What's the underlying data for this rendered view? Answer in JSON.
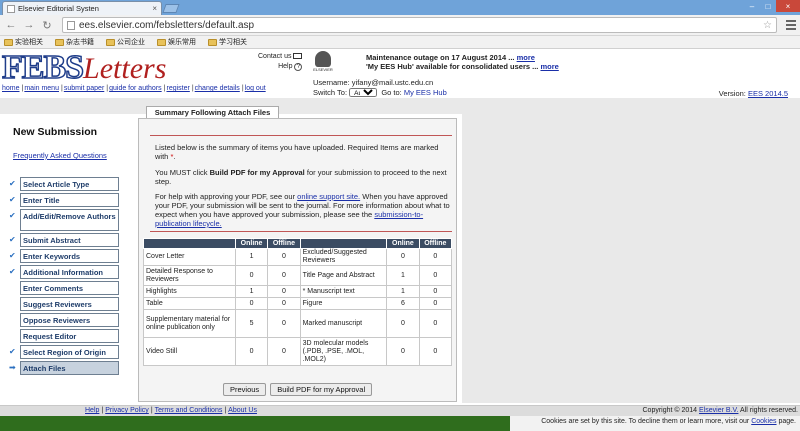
{
  "browser": {
    "tab_title": "Elsevier Editorial Systen",
    "tab_close": "×",
    "url": "ees.elsevier.com/febsletters/default.asp",
    "window_min": "–",
    "window_restore": "□",
    "window_close": "×",
    "bookmarks": [
      "实验相关",
      "杂志书籍",
      "公司企业",
      "娱乐常用",
      "学习相关"
    ]
  },
  "header": {
    "logo_febs": "FEBS",
    "logo_letters": "Letters",
    "contact_us": "Contact us",
    "help": "Help",
    "elsevier_label": "ELSEVIER",
    "maintenance_line1": "Maintenance outage on 17 August 2014 ...",
    "maintenance_more1": "more",
    "maintenance_line2": "'My EES Hub' available for consolidated users ...",
    "maintenance_more2": "more",
    "username_label": "Username:",
    "username": "yifany@mail.ustc.edu.cn",
    "switch_to_label": "Switch To:",
    "switch_to_value": "Author",
    "go_to_label": "Go to:",
    "go_to_link": "My EES Hub",
    "version_label": "Version:",
    "version_link": "EES 2014.5"
  },
  "topnav": [
    "home",
    "main menu",
    "submit paper",
    "guide for authors",
    "register",
    "change details",
    "log out"
  ],
  "sidebar": {
    "title": "New Submission",
    "faq": "Frequently Asked Questions",
    "steps": [
      {
        "label": "Select Article Type",
        "mark": "✔"
      },
      {
        "label": "Enter Title",
        "mark": "✔"
      },
      {
        "label": "Add/Edit/Remove Authors",
        "mark": "✔"
      },
      {
        "label": "Submit Abstract",
        "mark": "✔"
      },
      {
        "label": "Enter Keywords",
        "mark": "✔"
      },
      {
        "label": "Additional Information",
        "mark": "✔"
      },
      {
        "label": "Enter Comments",
        "mark": ""
      },
      {
        "label": "Suggest Reviewers",
        "mark": ""
      },
      {
        "label": "Oppose Reviewers",
        "mark": ""
      },
      {
        "label": "Request Editor",
        "mark": ""
      },
      {
        "label": "Select Region of Origin",
        "mark": "✔"
      },
      {
        "label": "Attach Files",
        "mark": "➡"
      }
    ]
  },
  "main": {
    "tab_title": "Summary Following Attach Files",
    "para1": "Listed below is the summary of items you have uploaded. Required Items are marked with",
    "para1_mark": "*",
    "para1_end": ".",
    "para2_start": "You MUST click",
    "para2_bold": "Build PDF for my Approval",
    "para2_end": "for your submission to proceed to the next step.",
    "para3_start": "For help with approving your PDF, see our",
    "para3_link1": "online support site.",
    "para3_mid": "When you have approved your PDF, your submission will be sent to the journal. For more information about what to expect when you have approved your submission, please see the",
    "para3_link2": "submission-to-publication lifecycle.",
    "table_headers": [
      "",
      "Online",
      "Offline",
      "",
      "Online",
      "Offline"
    ],
    "rows": [
      [
        "Cover Letter",
        "1",
        "0",
        "Excluded/Suggested Reviewers",
        "0",
        "0"
      ],
      [
        "Detailed Response to Reviewers",
        "0",
        "0",
        "Title Page and Abstract",
        "1",
        "0"
      ],
      [
        "Highlights",
        "1",
        "0",
        "* Manuscript text",
        "1",
        "0"
      ],
      [
        "Table",
        "0",
        "0",
        "Figure",
        "6",
        "0"
      ],
      [
        "Supplementary material for online publication only",
        "5",
        "0",
        "Marked manuscript",
        "0",
        "0"
      ],
      [
        "Video Still",
        "0",
        "0",
        "3D molecular models (.PDB, .PSE, .MOL, .MOL2)",
        "0",
        "0"
      ]
    ],
    "btn_previous": "Previous",
    "btn_build": "Build PDF for my Approval"
  },
  "footer": {
    "links": [
      "Help",
      "Privacy Policy",
      "Terms and Conditions",
      "About Us"
    ],
    "copyright": "Copyright © 2014",
    "copyright_link": "Elsevier B.V.",
    "copyright_end": "All rights reserved.",
    "cookie_line1": "Cookies are set by this site. To decline them or learn more, visit our",
    "cookie_link": "Cookies",
    "cookie_end": "page."
  }
}
